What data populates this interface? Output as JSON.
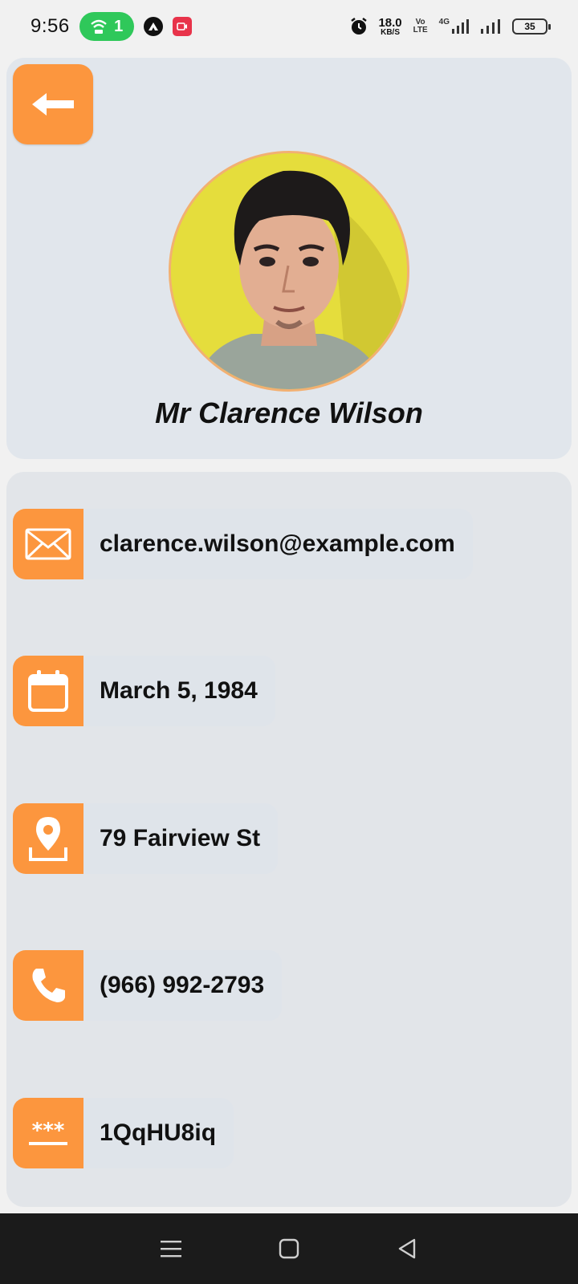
{
  "status_bar": {
    "time": "9:56",
    "hotspot_count": "1",
    "net_speed_value": "18.0",
    "net_speed_unit": "KB/S",
    "volte_label": "Vo LTE",
    "network_type": "4G",
    "battery_level": "35"
  },
  "header": {
    "back_icon": "arrow-left-icon"
  },
  "profile": {
    "name": "Mr Clarence Wilson",
    "accent_color": "#fc963e"
  },
  "info": {
    "items": [
      {
        "icon": "envelope-icon",
        "value": "clarence.wilson@example.com"
      },
      {
        "icon": "calendar-icon",
        "value": "March 5, 1984"
      },
      {
        "icon": "map-pin-icon",
        "value": "79 Fairview St"
      },
      {
        "icon": "phone-icon",
        "value": "(966) 992-2793"
      },
      {
        "icon": "password-icon",
        "value": "1QqHU8iq"
      }
    ]
  },
  "nav_bar": {
    "buttons": [
      "menu-icon",
      "home-icon",
      "back-triangle-icon"
    ]
  }
}
